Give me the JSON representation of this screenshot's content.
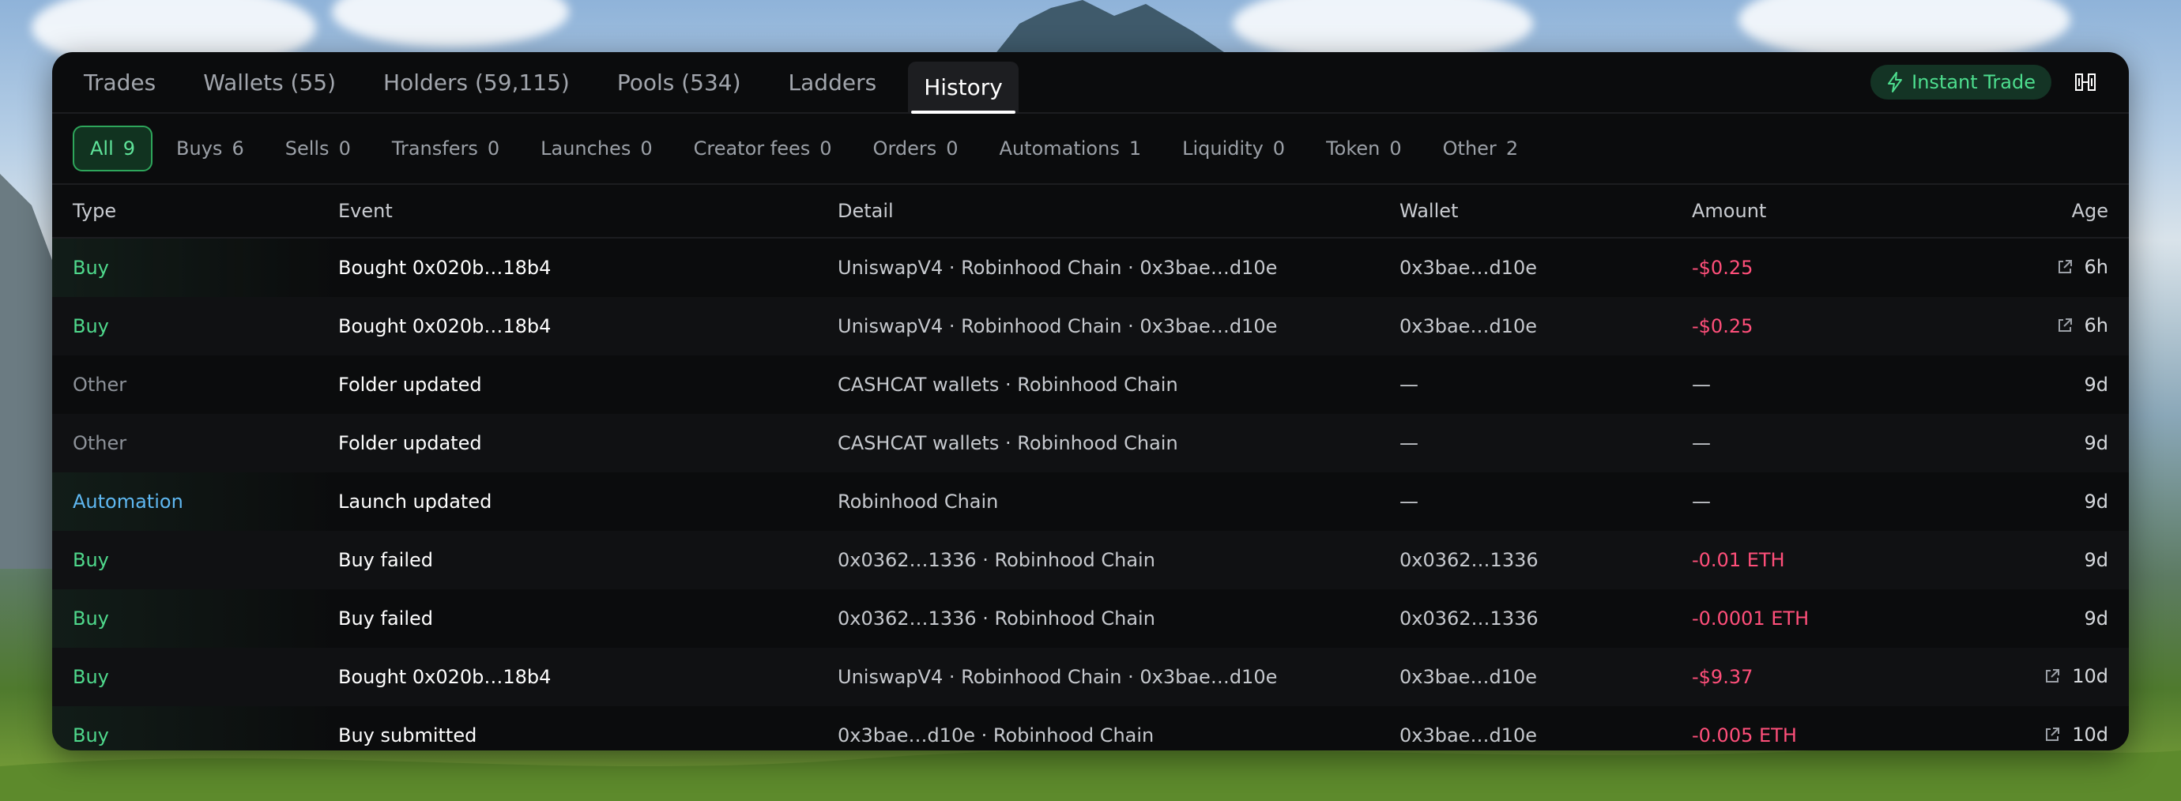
{
  "tabs": [
    {
      "label": "Trades"
    },
    {
      "label": "Wallets (55)"
    },
    {
      "label": "Holders (59,115)"
    },
    {
      "label": "Pools (534)"
    },
    {
      "label": "Ladders"
    },
    {
      "label": "History"
    }
  ],
  "active_tab": "History",
  "instant_trade_label": "Instant Trade",
  "filters": [
    {
      "label": "All",
      "count": "9"
    },
    {
      "label": "Buys",
      "count": "6"
    },
    {
      "label": "Sells",
      "count": "0"
    },
    {
      "label": "Transfers",
      "count": "0"
    },
    {
      "label": "Launches",
      "count": "0"
    },
    {
      "label": "Creator fees",
      "count": "0"
    },
    {
      "label": "Orders",
      "count": "0"
    },
    {
      "label": "Automations",
      "count": "1"
    },
    {
      "label": "Liquidity",
      "count": "0"
    },
    {
      "label": "Token",
      "count": "0"
    },
    {
      "label": "Other",
      "count": "2"
    }
  ],
  "columns": {
    "type": "Type",
    "event": "Event",
    "detail": "Detail",
    "wallet": "Wallet",
    "amount": "Amount",
    "age": "Age"
  },
  "rows": [
    {
      "type": "Buy",
      "event": "Bought 0x020b…18b4",
      "detail": "UniswapV4 · Robinhood Chain · 0x3bae…d10e",
      "wallet": "0x3bae…d10e",
      "amount": "-$0.25",
      "age": "6h"
    },
    {
      "type": "Buy",
      "event": "Bought 0x020b…18b4",
      "detail": "UniswapV4 · Robinhood Chain · 0x3bae…d10e",
      "wallet": "0x3bae…d10e",
      "amount": "-$0.25",
      "age": "6h"
    },
    {
      "type": "Other",
      "event": "Folder updated",
      "detail": "CASHCAT wallets · Robinhood Chain",
      "wallet": "—",
      "amount": "—",
      "age": "9d"
    },
    {
      "type": "Other",
      "event": "Folder updated",
      "detail": "CASHCAT wallets · Robinhood Chain",
      "wallet": "—",
      "amount": "—",
      "age": "9d"
    },
    {
      "type": "Automation",
      "event": "Launch updated",
      "detail": "Robinhood Chain",
      "wallet": "—",
      "amount": "—",
      "age": "9d"
    },
    {
      "type": "Buy",
      "event": "Buy failed",
      "detail": "0x0362…1336 · Robinhood Chain",
      "wallet": "0x0362…1336",
      "amount": "-0.01 ETH",
      "age": "9d"
    },
    {
      "type": "Buy",
      "event": "Buy failed",
      "detail": "0x0362…1336 · Robinhood Chain",
      "wallet": "0x0362…1336",
      "amount": "-0.0001 ETH",
      "age": "9d"
    },
    {
      "type": "Buy",
      "event": "Bought 0x020b…18b4",
      "detail": "UniswapV4 · Robinhood Chain · 0x3bae…d10e",
      "wallet": "0x3bae…d10e",
      "amount": "-$9.37",
      "age": "10d"
    },
    {
      "type": "Buy",
      "event": "Buy submitted",
      "detail": "0x3bae…d10e · Robinhood Chain",
      "wallet": "0x3bae…d10e",
      "amount": "-0.005 ETH",
      "age": "10d"
    }
  ],
  "colors": {
    "accent_green": "#4ddd8e",
    "negative": "#ff4f7a",
    "automation": "#5fb8f2"
  }
}
